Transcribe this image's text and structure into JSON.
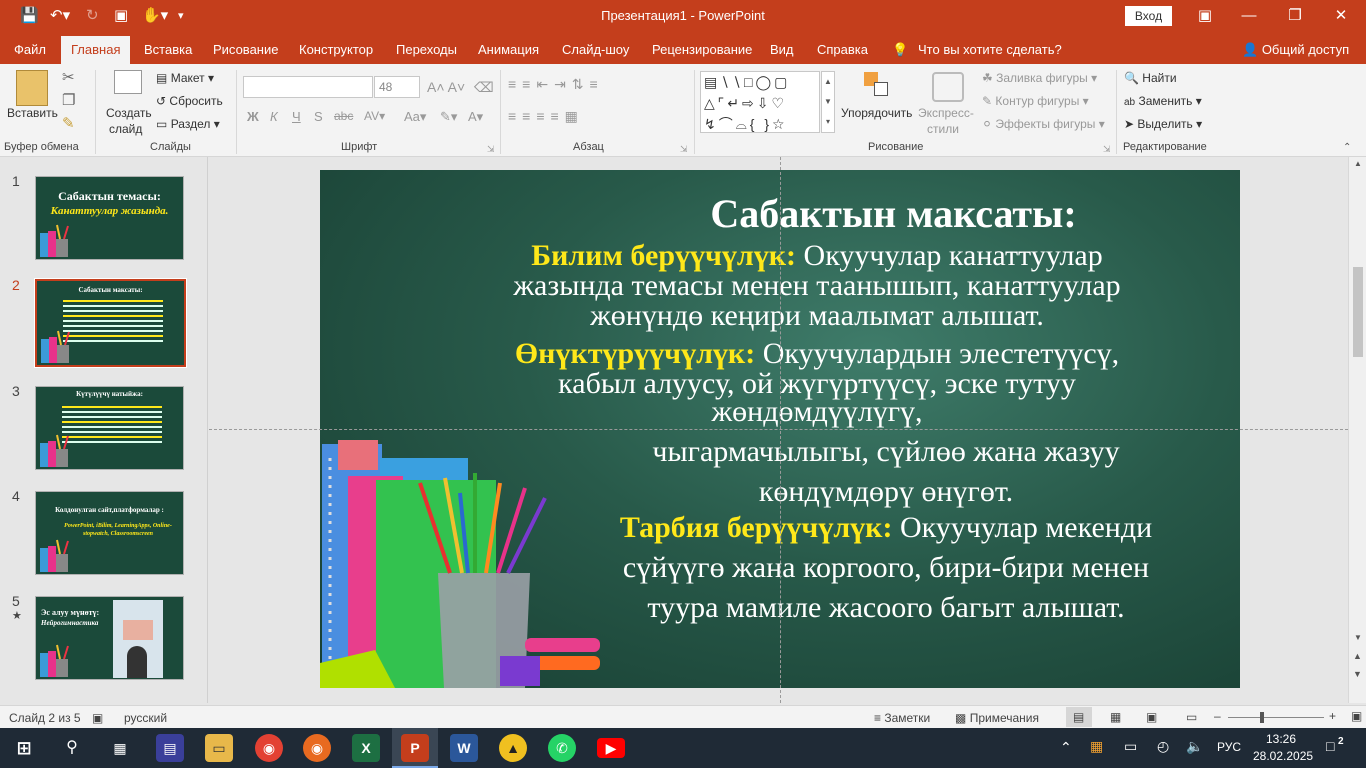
{
  "app": {
    "window_title": "Презентация1  -  PowerPoint",
    "signin_label": "Вход",
    "share_label": "Общий доступ",
    "tell_me": "Что вы хотите сделать?"
  },
  "tabs": [
    "Файл",
    "Главная",
    "Вставка",
    "Рисование",
    "Конструктор",
    "Переходы",
    "Анимация",
    "Слайд-шоу",
    "Рецензирование",
    "Вид",
    "Справка"
  ],
  "active_tab": "Главная",
  "ribbon": {
    "paste": "Вставить",
    "new_slide_1": "Создать",
    "new_slide_2": "слайд",
    "layout": "Макет",
    "reset": "Сбросить",
    "section": "Раздел",
    "font_size": "48",
    "arrange": "Упорядочить",
    "quick_styles_1": "Экспресс-",
    "quick_styles_2": "стили",
    "shape_fill": "Заливка фигуры",
    "shape_outline": "Контур фигуры",
    "shape_effects": "Эффекты фигуры",
    "find": "Найти",
    "replace": "Заменить",
    "select": "Выделить",
    "groups": {
      "clipboard": "Буфер обмена",
      "slides": "Слайды",
      "font": "Шрифт",
      "paragraph": "Абзац",
      "drawing": "Рисование",
      "editing": "Редактирование"
    }
  },
  "thumbnails": [
    {
      "num": "1",
      "title": "Сабактын темасы:",
      "subtitle": "Канаттуулар жазында."
    },
    {
      "num": "2",
      "title": "Сабактын максаты:",
      "selected": true
    },
    {
      "num": "3",
      "title": "Күтүлүүчү натыйжа:"
    },
    {
      "num": "4",
      "title": "Колдонулган сайт,платформалар :",
      "subtitle": "PowerPoint, iBilim, LearningApps, Online-stopwatch, Classroomscreen"
    },
    {
      "num": "5",
      "title": "Эс алуу мүнөтү:",
      "subtitle": "Нейрогимнастика"
    }
  ],
  "slide": {
    "title": "Сабактын максаты:",
    "b1_label": "Билим берүүчүлүк:",
    "b1_l1": "Окуучулар канаттуулар",
    "b1_l2": "жазында темасы менен таанышып, канаттуулар",
    "b1_l3": "жөнүндө кеңири маалымат алышат.",
    "b2_label": "Өнүктүрүүчүлүк:",
    "b2_l1": "Окуучулардын элестетүүсү,",
    "b2_l2": "кабыл алуусу, ой жүгүртүүсү, эске тутуу",
    "b2_l3": "жөндөмдүүлүгү,",
    "b2_l4": "чыгармачылыгы, сүйлөө жана жазуу",
    "b2_l5": "көндүмдөрү өнүгөт.",
    "b3_label": "Тарбия берүүчүлүк:",
    "b3_l1": "Окуучулар мекенди",
    "b3_l2": "сүйүүгө жана коргоого, бири-бири менен",
    "b3_l3": "туура мамиле жасоого багыт алышат."
  },
  "status": {
    "slide_counter": "Слайд 2 из 5",
    "language": "русский",
    "notes": "Заметки",
    "comments": "Примечания"
  },
  "taskbar": {
    "lang": "РУС",
    "time": "13:26",
    "date": "28.02.2025",
    "notifications": "2"
  },
  "colors": {
    "accent": "#c43e1c",
    "slide_bg": "#285a4a",
    "highlight_text": "#ffe81a"
  }
}
